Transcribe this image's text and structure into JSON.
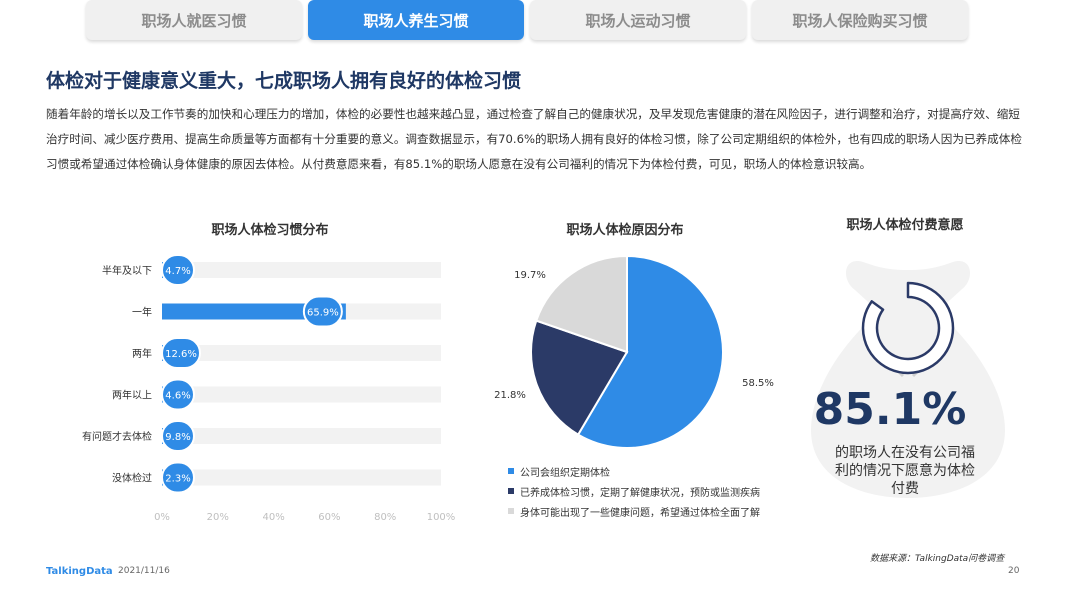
{
  "tabs": [
    {
      "label": "职场人就医习惯",
      "active": false
    },
    {
      "label": "职场人养生习惯",
      "active": true
    },
    {
      "label": "职场人运动习惯",
      "active": false
    },
    {
      "label": "职场人保险购买习惯",
      "active": false
    }
  ],
  "headline": "体检对于健康意义重大，七成职场人拥有良好的体检习惯",
  "body_text": "随着年龄的增长以及工作节奏的加快和心理压力的增加，体检的必要性也越来越凸显，通过检查了解自己的健康状况，及早发现危害健康的潜在风险因子，进行调整和治疗，对提高疗效、缩短治疗时间、减少医疗费用、提高生命质量等方面都有十分重要的意义。调查数据显示，有70.6%的职场人拥有良好的体检习惯，除了公司定期组织的体检外，也有四成的职场人因为已养成体检习惯或希望通过体检确认身体健康的原因去体检。从付费意愿来看，有85.1%的职场人愿意在没有公司福利的情况下为体检付费，可见，职场人的体检意识较高。",
  "colors": {
    "accent": "#2f8be6",
    "navy": "#2b3a67",
    "gray": "#d9d9d9",
    "track": "#f2f2f2",
    "title": "#1f3864"
  },
  "chart_data": [
    {
      "type": "bar",
      "orientation": "horizontal",
      "title": "职场人体检习惯分布",
      "categories": [
        "半年及以下",
        "一年",
        "两年",
        "两年以上",
        "有问题才去体检",
        "没体检过"
      ],
      "values": [
        4.7,
        65.9,
        12.6,
        4.6,
        9.8,
        2.3
      ],
      "value_labels": [
        "4.7%",
        "65.9%",
        "12.6%",
        "4.6%",
        "9.8%",
        "2.3%"
      ],
      "xlim": [
        0,
        100
      ],
      "x_ticks": [
        "0%",
        "20%",
        "40%",
        "60%",
        "80%",
        "100%"
      ],
      "bar_color": "#2f8be6"
    },
    {
      "type": "pie",
      "title": "职场人体检原因分布",
      "labels": [
        "公司会组织定期体检",
        "已养成体检习惯，定期了解健康状况，预防或监测疾病",
        "身体可能出现了一些健康问题，希望通过体检全面了解"
      ],
      "values": [
        58.5,
        21.8,
        19.7
      ],
      "value_labels": [
        "58.5%",
        "21.8%",
        "19.7%"
      ],
      "colors": [
        "#2f8be6",
        "#2b3a67",
        "#d9d9d9"
      ],
      "legend_position": "bottom"
    },
    {
      "type": "gauge",
      "title": "职场人体检付费意愿",
      "value": 85.1,
      "value_label": "85.1%",
      "description": "的职场人在没有公司福利的情况下愿意为体检付费"
    }
  ],
  "footer": {
    "logo": "TalkingData",
    "date": "2021/11/16",
    "source": "数据来源：TalkingData问卷调查",
    "page": "20"
  }
}
